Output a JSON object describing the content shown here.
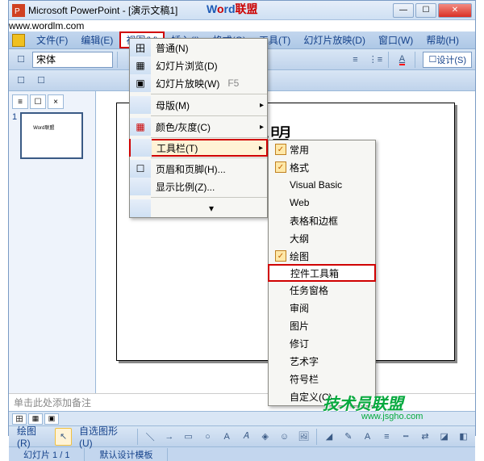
{
  "title": "Microsoft PowerPoint - [演示文稿1]",
  "watermark": {
    "prefix": "W",
    "mid1": "o",
    "mid2": "rd",
    "suffix": "联盟",
    "url": "www.wordlm.com"
  },
  "menubar": {
    "file": "文件(F)",
    "edit": "编辑(E)",
    "view": "视图(V)",
    "insert": "插入(I)",
    "format": "格式(O)",
    "tools": "工具(T)",
    "slideshow": "幻灯片放映(D)",
    "window": "窗口(W)",
    "help": "帮助(H)"
  },
  "toolbar": {
    "font": "宋体",
    "design": "设计(S)"
  },
  "thumb_num": "1",
  "thumb_text": "Word联盟",
  "slide_title": "rd联盟",
  "notes_placeholder": "单击此处添加备注",
  "drawbar": {
    "draw": "绘图(R)",
    "autoshape": "自选图形(U)"
  },
  "status": {
    "slide": "幻灯片 1 / 1",
    "template": "默认设计模板"
  },
  "view_menu": {
    "normal": "普通(N)",
    "slidebrowse": "幻灯片浏览(D)",
    "slideshow": "幻灯片放映(W)",
    "f5": "F5",
    "master": "母版(M)",
    "color": "颜色/灰度(C)",
    "toolbar": "工具栏(T)",
    "headerfooter": "页眉和页脚(H)...",
    "zoom": "显示比例(Z)...",
    "expand": "▾"
  },
  "toolbar_menu": {
    "items": [
      {
        "label": "常用",
        "checked": true
      },
      {
        "label": "格式",
        "checked": true
      },
      {
        "label": "Visual Basic",
        "checked": false
      },
      {
        "label": "Web",
        "checked": false
      },
      {
        "label": "表格和边框",
        "checked": false
      },
      {
        "label": "大纲",
        "checked": false
      },
      {
        "label": "绘图",
        "checked": true
      },
      {
        "label": "控件工具箱",
        "checked": false,
        "highlight": true
      },
      {
        "label": "任务窗格",
        "checked": false
      },
      {
        "label": "审阅",
        "checked": false
      },
      {
        "label": "图片",
        "checked": false
      },
      {
        "label": "修订",
        "checked": false
      },
      {
        "label": "艺术字",
        "checked": false
      },
      {
        "label": "符号栏",
        "checked": false
      },
      {
        "label": "自定义(C)...",
        "checked": false
      }
    ]
  },
  "overlay": {
    "logo": "技术员联盟",
    "url": "www.jsgho.com"
  }
}
